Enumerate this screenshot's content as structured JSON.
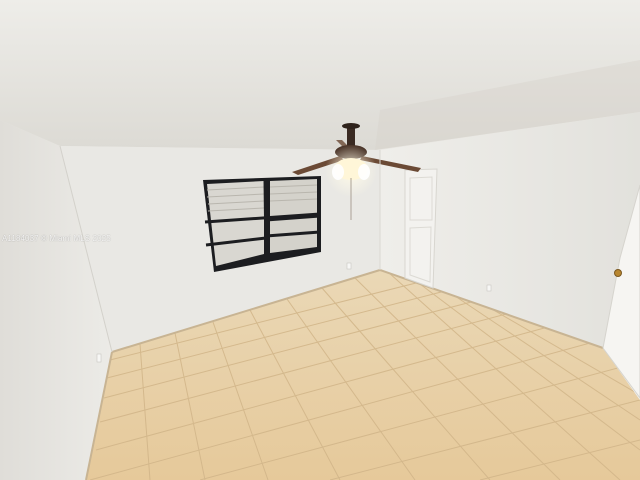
{
  "photo": {
    "watermark": "A1184037 © Miami MLS 2025",
    "colors": {
      "ceiling": "#f1f0ec",
      "ceiling_shadow": "#cfccc4",
      "left_wall": "#e7e5e0",
      "back_wall": "#ecebe7",
      "right_wall": "#e6e5e1",
      "floor_tile": "#e7cfa6",
      "grout": "#d4b98e",
      "baseboard": "#c9b79a",
      "window_frame": "#1c1d20",
      "blinds": "#d8d6d0",
      "door": "#f4f3f0",
      "fan_body": "#3a2a22",
      "fan_blade": "#6b4a35",
      "light": "#fff6d8"
    }
  }
}
